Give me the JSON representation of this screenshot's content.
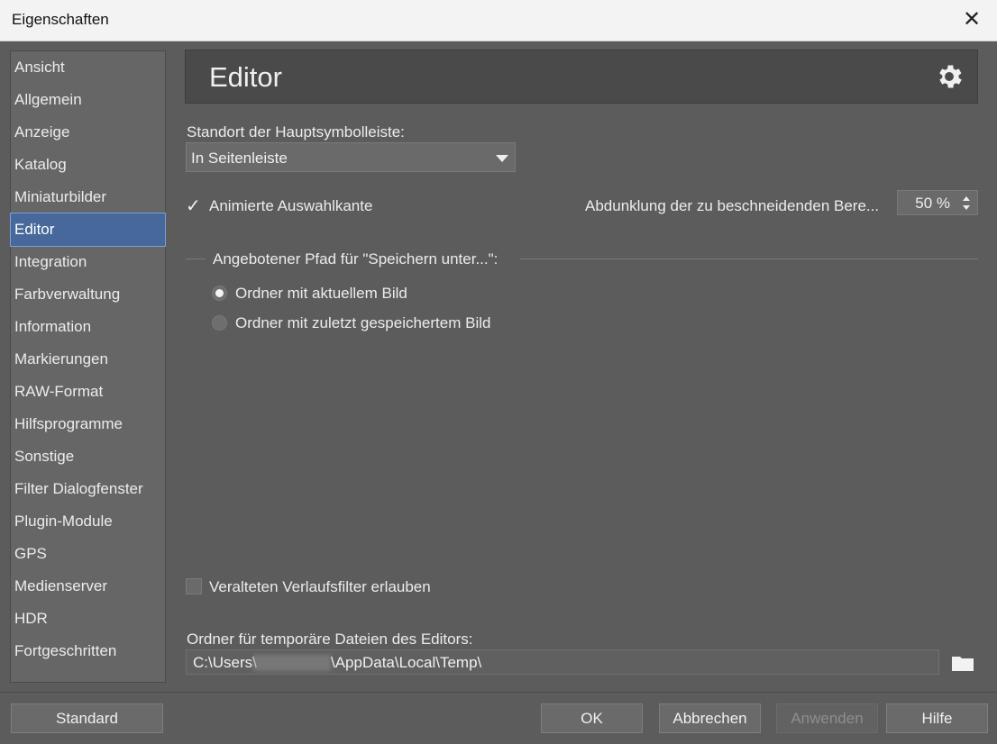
{
  "window": {
    "title": "Eigenschaften"
  },
  "sidebar": {
    "items": [
      "Ansicht",
      "Allgemein",
      "Anzeige",
      "Katalog",
      "Miniaturbilder",
      "Editor",
      "Integration",
      "Farbverwaltung",
      "Information",
      "Markierungen",
      "RAW-Format",
      "Hilfsprogramme",
      "Sonstige",
      "Filter Dialogfenster",
      "Plugin-Module",
      "GPS",
      "Medienserver",
      "HDR",
      "Fortgeschritten"
    ],
    "active_index": 5
  },
  "header": {
    "title": "Editor",
    "icon": "gear-icon"
  },
  "toolbar_location": {
    "label": "Standort der Hauptsymbolleiste:",
    "value": "In Seitenleiste"
  },
  "animated_selection": {
    "label": "Animierte Auswahlkante",
    "checked": true
  },
  "crop_darkening": {
    "label": "Abdunklung der zu beschneidenden Bere...",
    "value": "50 %"
  },
  "save_path_group": {
    "title": "Angebotener Pfad für \"Speichern unter...\":",
    "options": [
      "Ordner mit aktuellem Bild",
      "Ordner mit zuletzt gespeichertem Bild"
    ],
    "selected_index": 0
  },
  "legacy_gradient": {
    "label": "Veralteten Verlaufsfilter erlauben",
    "checked": false
  },
  "temp_folder": {
    "label": "Ordner für temporäre Dateien des Editors:",
    "path_prefix": "C:\\Users\\",
    "path_suffix": "\\AppData\\Local\\Temp\\"
  },
  "buttons": {
    "standard": "Standard",
    "ok": "OK",
    "cancel": "Abbrechen",
    "apply": "Anwenden",
    "help": "Hilfe"
  }
}
